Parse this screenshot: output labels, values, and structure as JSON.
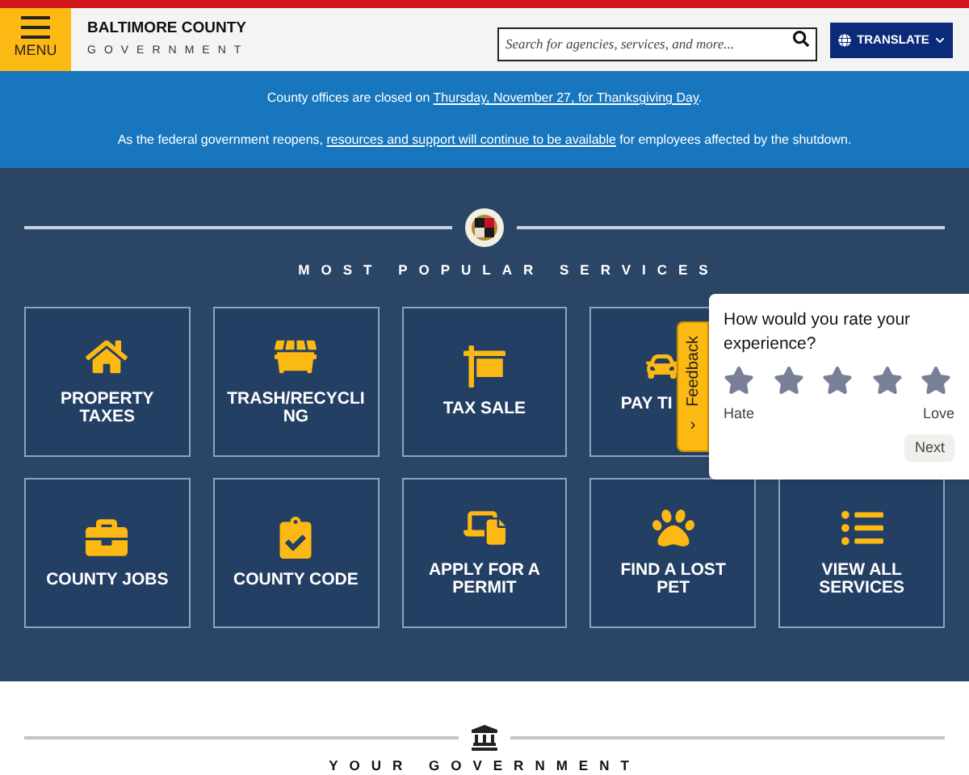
{
  "header": {
    "menu_label": "MENU",
    "logo_title": "BALTIMORE COUNTY",
    "logo_subtitle": "GOVERNMENT",
    "search": {
      "placeholder": "Search for agencies, services, and more..."
    },
    "translate_label": "TRANSLATE"
  },
  "alerts": [
    {
      "before": "County offices are closed on ",
      "link": "Thursday, November 27, for Thanksgiving Day",
      "after": "."
    },
    {
      "before": "As the federal government reopens, ",
      "link": "resources and support will continue to be available",
      "after": " for employees affected by the shutdown."
    }
  ],
  "services": {
    "heading": "MOST POPULAR SERVICES",
    "rows": [
      {
        "tiles": [
          {
            "label": "PROPERTY TAXES"
          },
          {
            "label": "TRASH/RECYCLI NG"
          },
          {
            "label": "TAX SALE"
          },
          {
            "label": "PAY TI"
          }
        ]
      },
      {
        "tiles": [
          {
            "label": "COUNTY JOBS"
          },
          {
            "label": "COUNTY CODE"
          },
          {
            "label": "APPLY FOR A PERMIT"
          },
          {
            "label": "FIND A LOST PET"
          },
          {
            "label": "VIEW ALL SERVICES"
          }
        ]
      }
    ]
  },
  "feedback": {
    "tab_label": "Feedback",
    "tab_arrow": "›",
    "question": "How would you rate your experience?",
    "low_label": "Hate",
    "high_label": "Love",
    "next_label": "Next"
  },
  "government": {
    "heading": "YOUR GOVERNMENT"
  }
}
